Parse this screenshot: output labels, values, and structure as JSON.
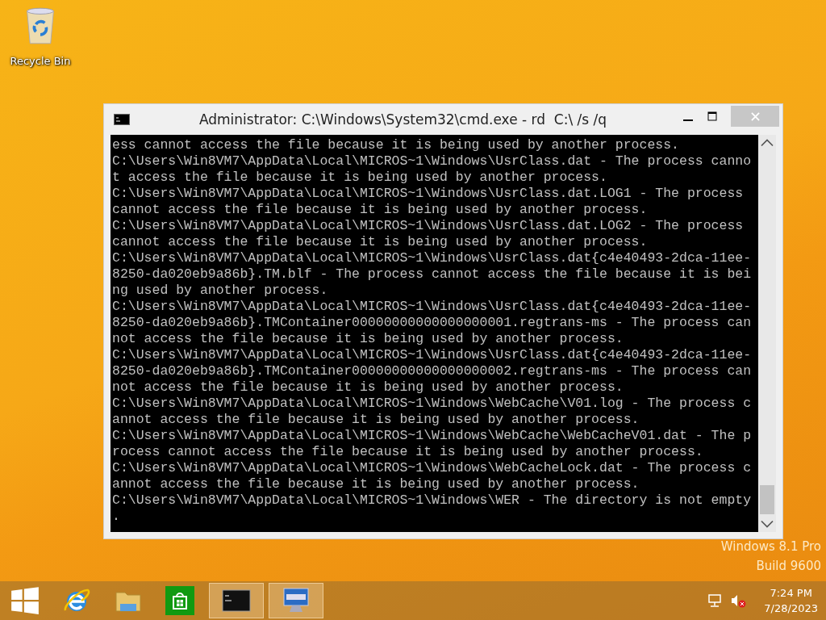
{
  "desktop": {
    "icons": [
      {
        "label": "Recycle Bin"
      }
    ],
    "watermark": [
      "Windows 8.1 Pro",
      "Build 9600"
    ]
  },
  "window": {
    "title": "Administrator: C:\\Windows\\System32\\cmd.exe - rd  C:\\ /s /q",
    "lines": [
      "ess cannot access the file because it is being used by another process.",
      "C:\\Users\\Win8VM7\\AppData\\Local\\MICROS~1\\Windows\\UsrClass.dat - The process canno",
      "t access the file because it is being used by another process.",
      "C:\\Users\\Win8VM7\\AppData\\Local\\MICROS~1\\Windows\\UsrClass.dat.LOG1 - The process",
      "cannot access the file because it is being used by another process.",
      "C:\\Users\\Win8VM7\\AppData\\Local\\MICROS~1\\Windows\\UsrClass.dat.LOG2 - The process",
      "cannot access the file because it is being used by another process.",
      "C:\\Users\\Win8VM7\\AppData\\Local\\MICROS~1\\Windows\\UsrClass.dat{c4e40493-2dca-11ee-",
      "8250-da020eb9a86b}.TM.blf - The process cannot access the file because it is bei",
      "ng used by another process.",
      "C:\\Users\\Win8VM7\\AppData\\Local\\MICROS~1\\Windows\\UsrClass.dat{c4e40493-2dca-11ee-",
      "8250-da020eb9a86b}.TMContainer00000000000000000001.regtrans-ms - The process can",
      "not access the file because it is being used by another process.",
      "C:\\Users\\Win8VM7\\AppData\\Local\\MICROS~1\\Windows\\UsrClass.dat{c4e40493-2dca-11ee-",
      "8250-da020eb9a86b}.TMContainer00000000000000000002.regtrans-ms - The process can",
      "not access the file because it is being used by another process.",
      "C:\\Users\\Win8VM7\\AppData\\Local\\MICROS~1\\Windows\\WebCache\\V01.log - The process c",
      "annot access the file because it is being used by another process.",
      "C:\\Users\\Win8VM7\\AppData\\Local\\MICROS~1\\Windows\\WebCache\\WebCacheV01.dat - The p",
      "rocess cannot access the file because it is being used by another process.",
      "C:\\Users\\Win8VM7\\AppData\\Local\\MICROS~1\\Windows\\WebCacheLock.dat - The process c",
      "annot access the file because it is being used by another process.",
      "C:\\Users\\Win8VM7\\AppData\\Local\\MICROS~1\\Windows\\WER - The directory is not empty",
      "."
    ]
  },
  "taskbar": {
    "items": [
      {
        "kind": "start",
        "running": false
      },
      {
        "kind": "browser",
        "running": false
      },
      {
        "kind": "folder",
        "running": false
      },
      {
        "kind": "store",
        "running": false
      },
      {
        "kind": "console",
        "running": true
      },
      {
        "kind": "monitor",
        "running": true
      }
    ],
    "tray": {
      "time": "7:24 PM",
      "date": "7/28/2023"
    }
  }
}
